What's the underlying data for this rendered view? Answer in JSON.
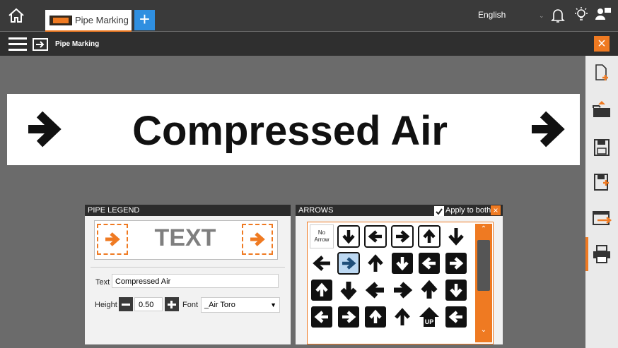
{
  "app": {
    "tab_label": "Pipe Marking",
    "language": "English",
    "subtitle": "Pipe Marking"
  },
  "colors": {
    "accent": "#ef7a22",
    "tab_add": "#2f8fe0",
    "topbar": "#3a3a3a",
    "workspace": "#6b6b6b"
  },
  "icons": {
    "home": "home-icon",
    "add_tab": "plus-icon",
    "bell": "bell-icon",
    "bulb": "lightbulb-icon",
    "user": "user-icon",
    "menu": "hamburger-icon",
    "close": "close-icon"
  },
  "toolbar": [
    {
      "name": "new-file-button"
    },
    {
      "name": "open-folder-button"
    },
    {
      "name": "save-button"
    },
    {
      "name": "save-as-button"
    },
    {
      "name": "transfer-button"
    },
    {
      "name": "print-button"
    }
  ],
  "banner": {
    "text": "Compressed Air",
    "left_arrow": "→",
    "right_arrow": "→"
  },
  "legend": {
    "title": "PIPE LEGEND",
    "preview_text": "TEXT",
    "text_label": "Text",
    "text_value": "Compressed Air",
    "height_label": "Height",
    "height_value": "0.50",
    "font_label": "Font",
    "font_value": "_Air Toro"
  },
  "arrows": {
    "title": "ARROWS",
    "apply_label": "Apply to both",
    "apply_checked": true,
    "no_arrow_line1": "No",
    "no_arrow_line2": "Arrow",
    "up_label": "UP",
    "selected_index": 7
  }
}
